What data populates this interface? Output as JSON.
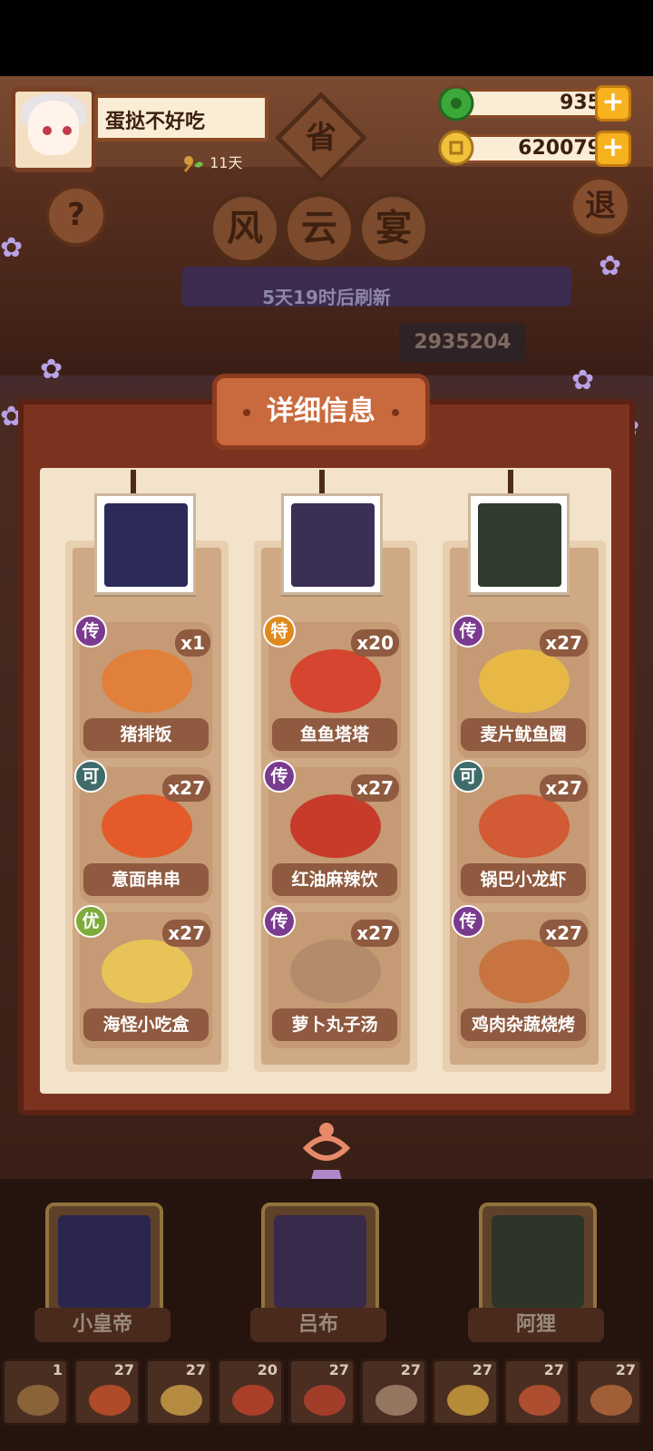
{
  "player": {
    "name": "蛋挞不好吃",
    "days": "11天"
  },
  "currency": {
    "jade": "935",
    "gold": "620079"
  },
  "title": {
    "badge": "省",
    "chars": [
      "风",
      "云",
      "宴"
    ]
  },
  "buttons": {
    "help": "?",
    "exit": "退"
  },
  "refresh_text": "5天19时后刷新",
  "score": "2935204",
  "panel_title": "详细信息",
  "chefs": [
    {
      "name": "小皇帝",
      "color": "#2b2a5a"
    },
    {
      "name": "吕布",
      "color": "#3b2f55"
    },
    {
      "name": "阿狸",
      "color": "#2f3b2e"
    }
  ],
  "columns": [
    [
      {
        "grade": "传",
        "qty": "x1",
        "name": "猪排饭",
        "color": "#e0803b"
      },
      {
        "grade": "可",
        "qty": "x27",
        "name": "意面串串",
        "color": "#e45a2a"
      },
      {
        "grade": "优",
        "qty": "x27",
        "name": "海怪小吃盒",
        "color": "#e8c357"
      }
    ],
    [
      {
        "grade": "特",
        "qty": "x20",
        "name": "鱼鱼塔塔",
        "color": "#d6452f"
      },
      {
        "grade": "传",
        "qty": "x27",
        "name": "红油麻辣饮",
        "color": "#c83a2a"
      },
      {
        "grade": "传",
        "qty": "x27",
        "name": "萝卜丸子汤",
        "color": "#b48c6c"
      }
    ],
    [
      {
        "grade": "传",
        "qty": "x27",
        "name": "麦片鱿鱼圈",
        "color": "#e7b845"
      },
      {
        "grade": "可",
        "qty": "x27",
        "name": "锅巴小龙虾",
        "color": "#d25a35"
      },
      {
        "grade": "传",
        "qty": "x27",
        "name": "鸡肉杂蔬烧烤",
        "color": "#c77440"
      }
    ]
  ],
  "tray": [
    {
      "count": "1",
      "color": "#9a7040"
    },
    {
      "count": "27",
      "color": "#c8532a"
    },
    {
      "count": "27",
      "color": "#d0a24a"
    },
    {
      "count": "20",
      "color": "#c0432a"
    },
    {
      "count": "27",
      "color": "#b8412c"
    },
    {
      "count": "27",
      "color": "#a88a72"
    },
    {
      "count": "27",
      "color": "#cfa23e"
    },
    {
      "count": "27",
      "color": "#c55634"
    },
    {
      "count": "27",
      "color": "#b86a3c"
    }
  ]
}
